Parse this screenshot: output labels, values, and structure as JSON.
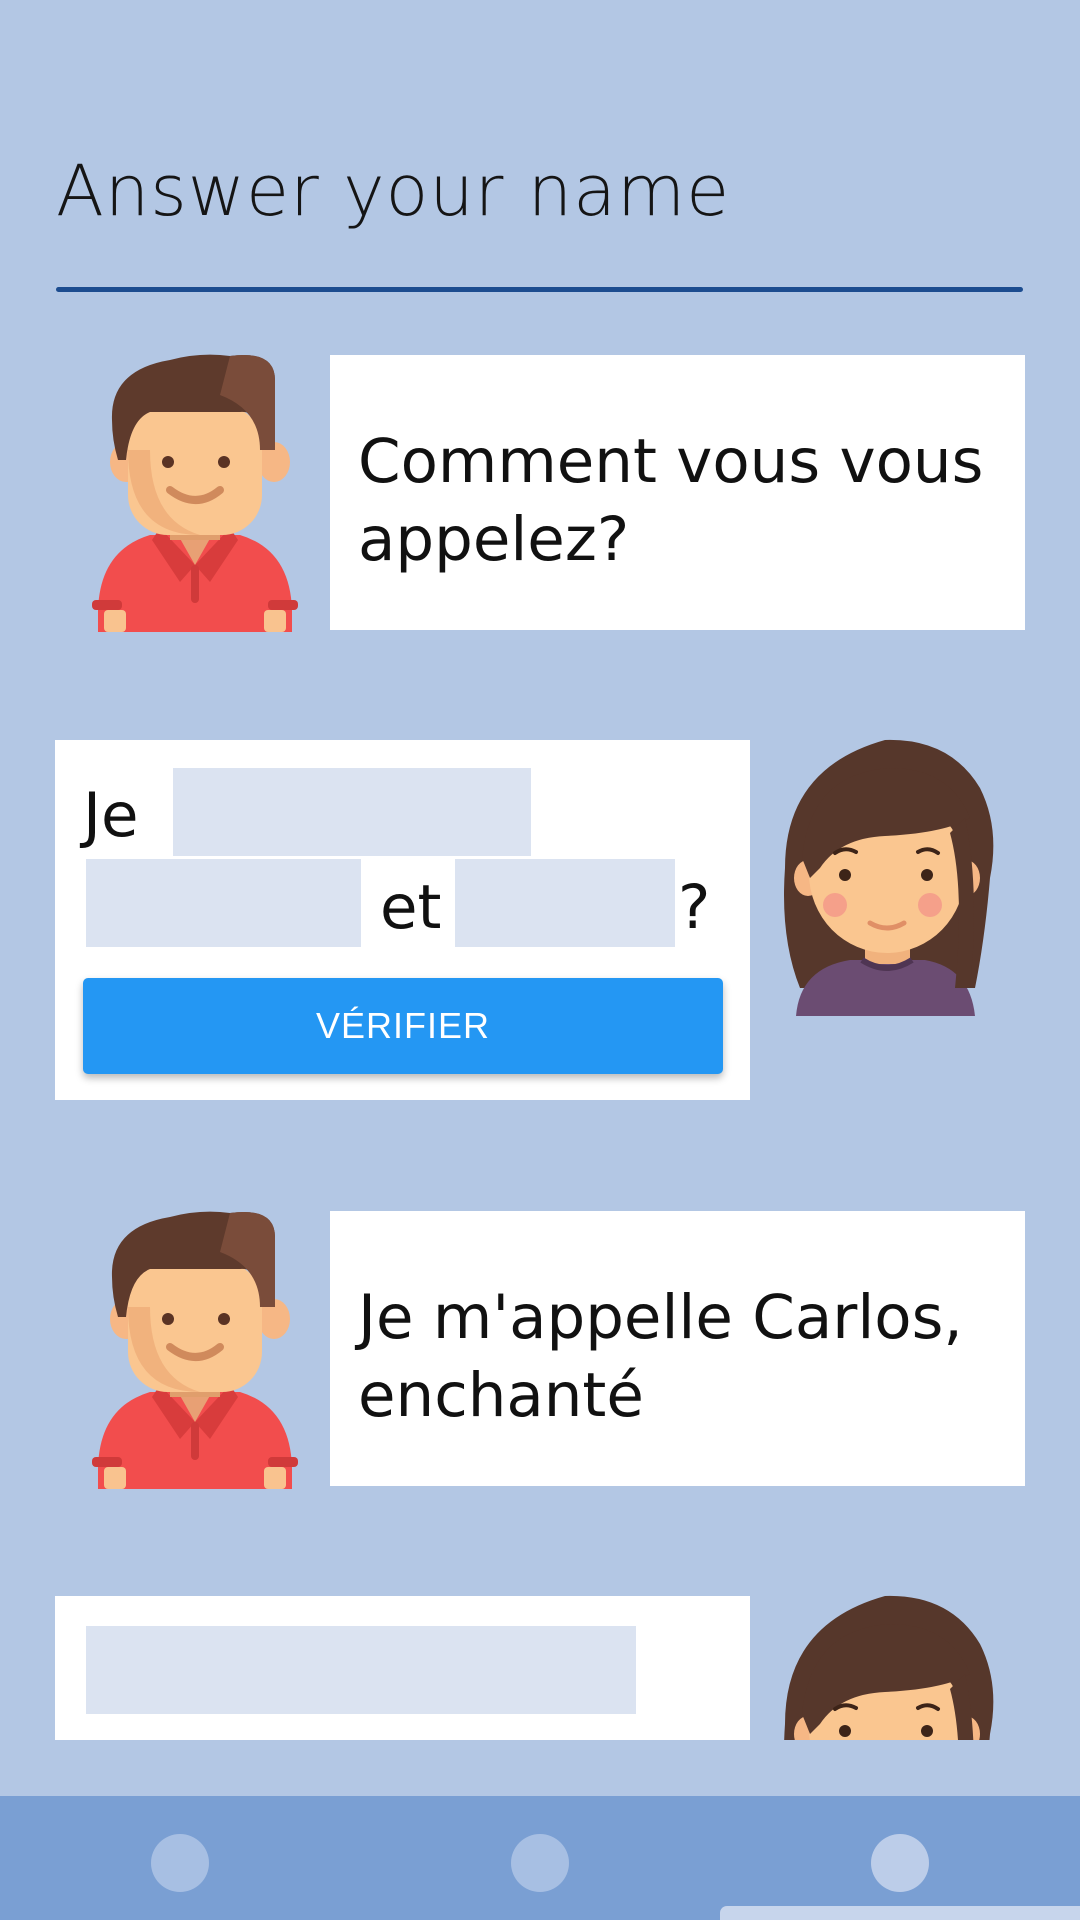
{
  "header": {
    "title": "Answer your name"
  },
  "dialogue": {
    "line1": {
      "speaker_icon": "boy-avatar-icon",
      "text": "Comment vous vous appelez?"
    },
    "line2": {
      "speaker_icon": "girl-avatar-icon",
      "word_je": "Je",
      "word_et": "et",
      "word_question": "?",
      "blank1_value": "",
      "blank2_value": "",
      "blank3_value": "",
      "verify_label": "VÉRIFIER"
    },
    "line3": {
      "speaker_icon": "boy-avatar-icon",
      "text": "Je m'appelle Carlos, enchanté"
    },
    "line4": {
      "speaker_icon": "girl-avatar-icon",
      "blank_value": ""
    }
  },
  "bottom_nav": {
    "items": [
      "nav-dot-1",
      "nav-dot-2",
      "nav-dot-3"
    ],
    "active_index": 2
  },
  "colors": {
    "background": "#b3c7e4",
    "accent": "#2497f3",
    "underline": "#1c4c8f",
    "blank_fill": "#dbe3f1",
    "bottom_bar": "#7a9fd3"
  }
}
